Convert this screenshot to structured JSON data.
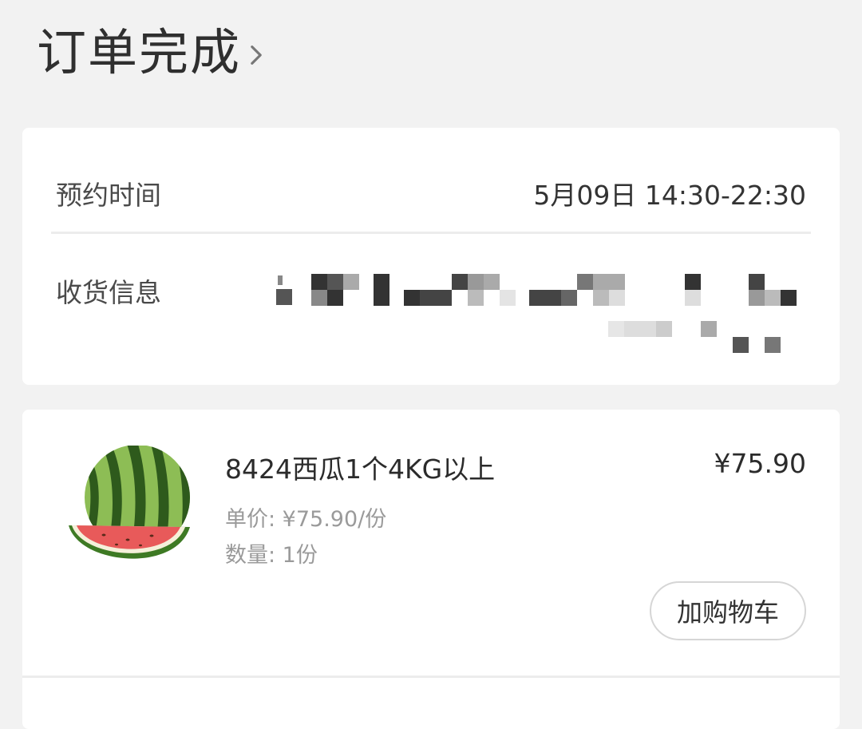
{
  "header": {
    "title": "订单完成",
    "chevron_icon": "chevron-right-icon"
  },
  "info_card": {
    "appointment_label": "预约时间",
    "appointment_value": "5月09日 14:30-22:30",
    "address_label": "收货信息"
  },
  "product": {
    "image_icon": "watermelon-icon",
    "name": "8424西瓜1个4KG以上",
    "price": "¥75.90",
    "unit_price": "单价: ¥75.90/份",
    "quantity": "数量: 1份",
    "add_to_cart_label": "加购物车"
  },
  "colors": {
    "background": "#f2f2f2",
    "card": "#ffffff",
    "text_primary": "#333333",
    "text_secondary": "#9a9a9a"
  }
}
